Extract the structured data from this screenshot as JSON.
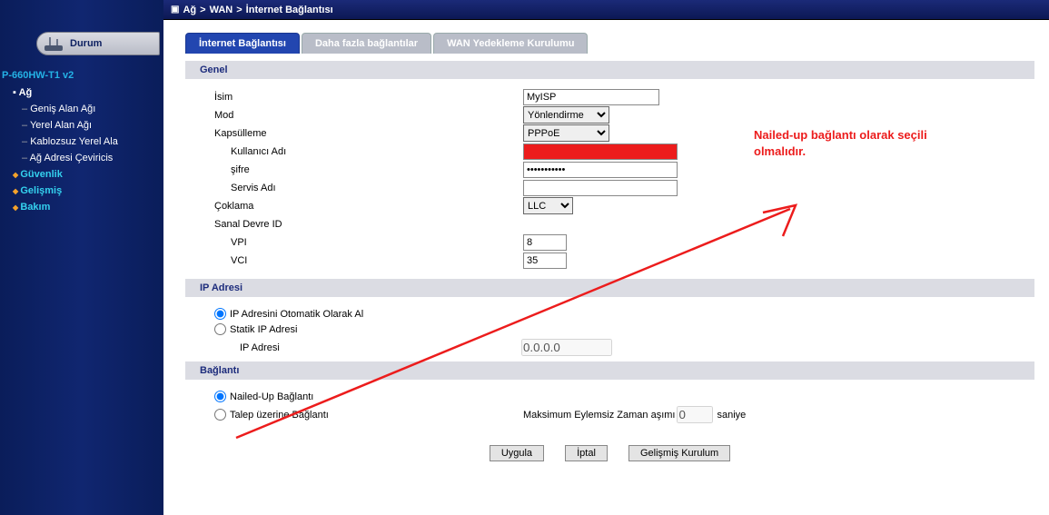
{
  "breadcrumb": {
    "root": "Ağ",
    "mid": "WAN",
    "leaf": "İnternet Bağlantısı"
  },
  "sidebar": {
    "durum": "Durum",
    "device": "P-660HW-T1 v2",
    "ag": "Ağ",
    "ag_children": {
      "wan": "Geniş Alan Ağı",
      "lan": "Yerel Alan Ağı",
      "wlan": "Kablozsuz Yerel Ala",
      "nat": "Ağ Adresi Çeviricis"
    },
    "guvenlik": "Güvenlik",
    "gelismis": "Gelişmiş",
    "bakim": "Bakım"
  },
  "tabs": {
    "t1": "İnternet Bağlantısı",
    "t2": "Daha fazla bağlantılar",
    "t3": "WAN Yedekleme Kurulumu"
  },
  "sections": {
    "genel": "Genel",
    "ip": "IP Adresi",
    "baglanti": "Bağlantı"
  },
  "form": {
    "isim_label": "İsim",
    "isim_value": "MyISP",
    "mod_label": "Mod",
    "mod_value": "Yönlendirme",
    "kapsulleme_label": "Kapsülleme",
    "kapsulleme_value": "PPPoE",
    "kullanici_label": "Kullanıcı Adı",
    "kullanici_value": "████████████",
    "sifre_label": "şifre",
    "sifre_value": "•••••••••••",
    "servis_label": "Servis Adı",
    "servis_value": "",
    "coklama_label": "Çoklama",
    "coklama_value": "LLC",
    "vcircuit_label": "Sanal Devre ID",
    "vpi_label": "VPI",
    "vpi_value": "8",
    "vci_label": "VCI",
    "vci_value": "35"
  },
  "ip": {
    "auto": "IP Adresini Otomatik Olarak Al",
    "static": "Statik IP Adresi",
    "addr_label": "IP Adresi",
    "addr_value": "0.0.0.0"
  },
  "conn": {
    "nailed": "Nailed-Up Bağlantı",
    "ondemand": "Talep üzerine Bağlantı",
    "timeout_label": "Maksimum Eylemsiz Zaman aşımı",
    "timeout_value": "0",
    "timeout_unit": "saniye"
  },
  "buttons": {
    "apply": "Uygula",
    "cancel": "İptal",
    "advanced": "Gelişmiş Kurulum"
  },
  "annotation": "Nailed-up bağlantı olarak seçili olmalıdır."
}
